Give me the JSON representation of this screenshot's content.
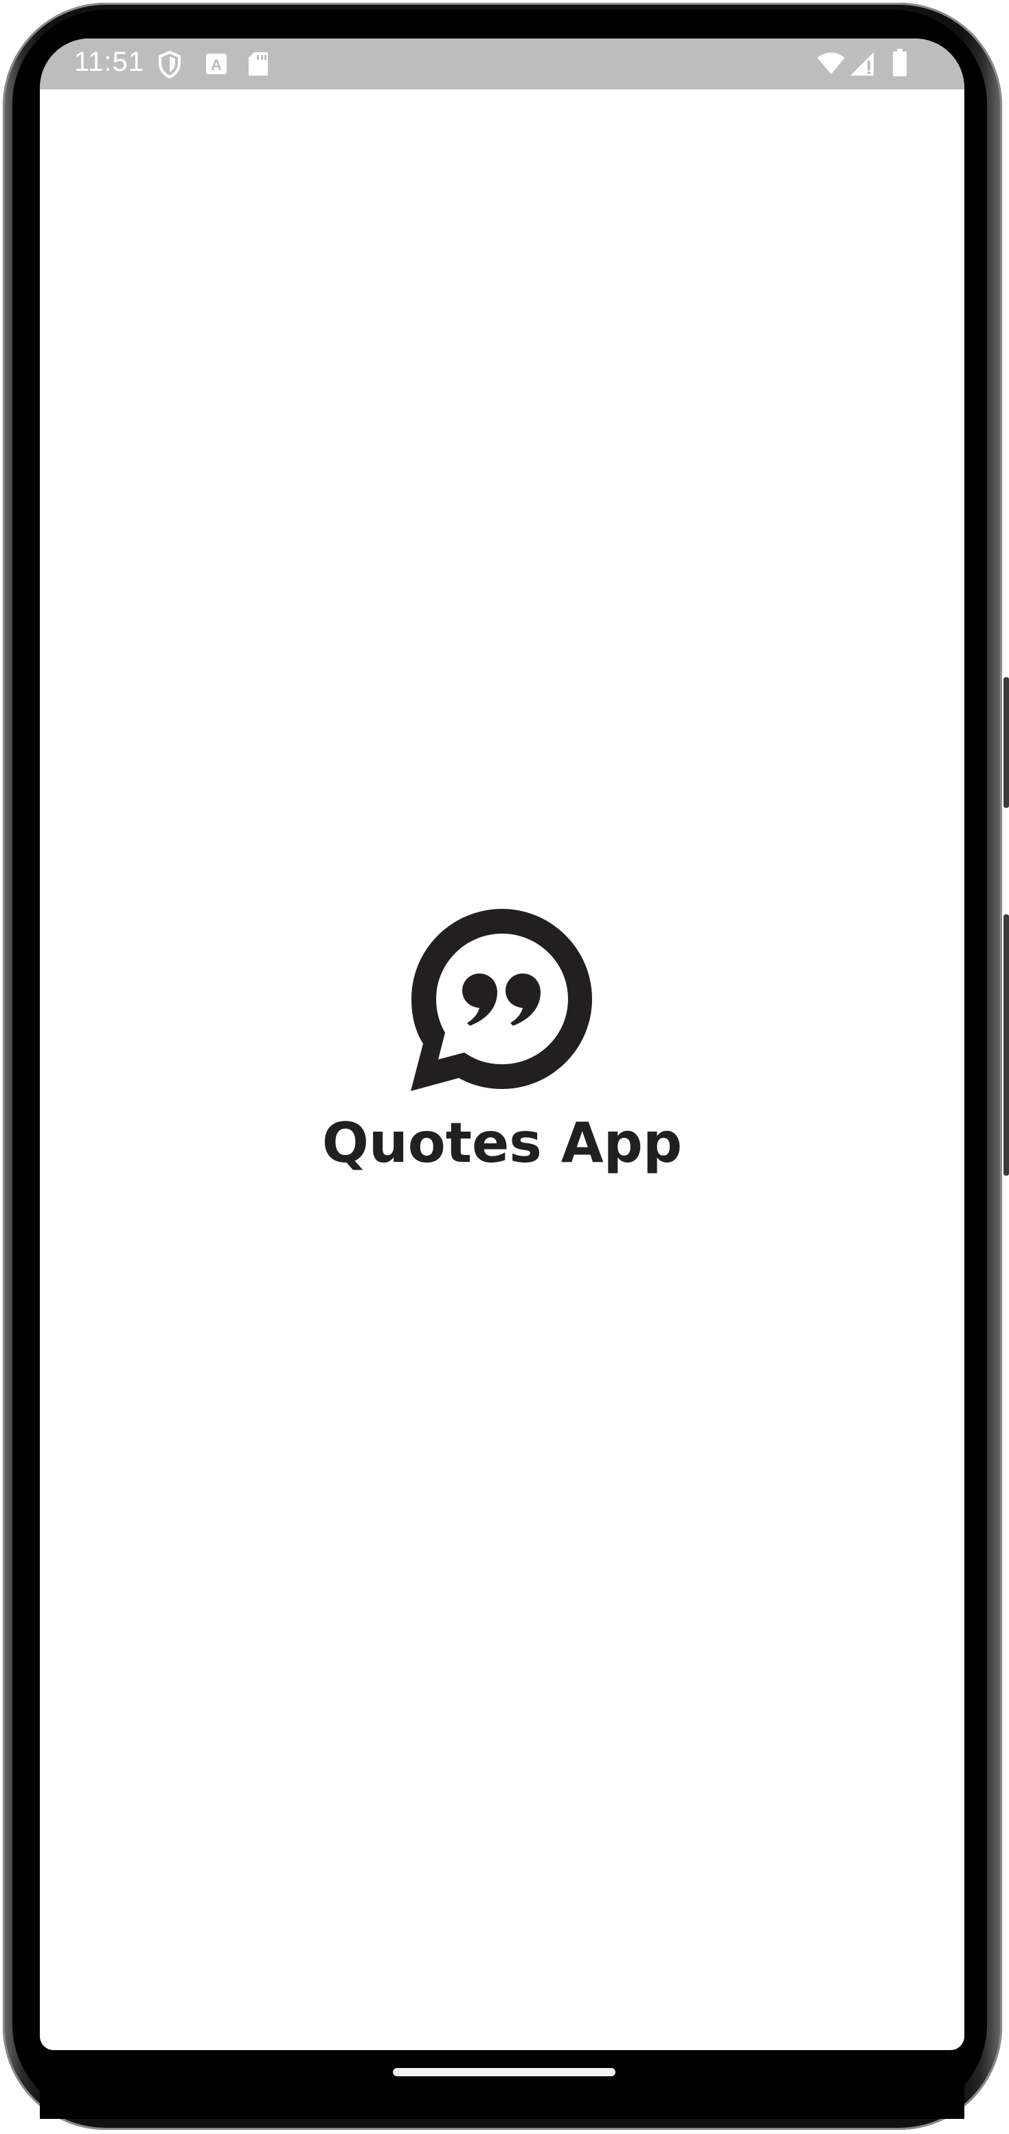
{
  "status_bar": {
    "time": "11:51",
    "left_icons": [
      "shield-icon",
      "a-notification-icon",
      "sd-card-icon"
    ],
    "right_icons": [
      "wifi-icon",
      "signal-icon",
      "battery-icon"
    ]
  },
  "splash": {
    "logo_icon": "quote-bubble-icon",
    "app_name": "Quotes App"
  },
  "colors": {
    "status_bar_bg": "#bdbdbd",
    "logo_color": "#221f20",
    "background": "#ffffff"
  }
}
